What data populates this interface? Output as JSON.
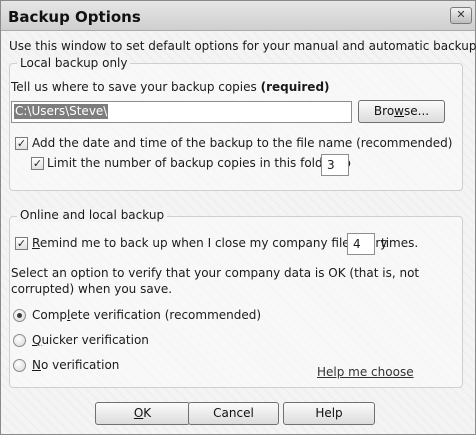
{
  "window": {
    "title": "Backup Options",
    "close_glyph": "✕",
    "intro_text": "Use this window to set default options for your manual and automatic backups."
  },
  "local_backup": {
    "group_title": "Local backup only",
    "location_prompt": "Tell us where to save your backup copies ",
    "location_required": "(required)",
    "location_value": "C:\\Users\\Steve\\",
    "browse_label_pre": "Bro",
    "browse_label_mnemonic": "w",
    "browse_label_post": "se...",
    "add_datetime_checked": true,
    "add_datetime_label": "Add the date and time of the backup to the file name (recommended)",
    "limit_copies_checked": true,
    "limit_copies_label": "Limit the number of backup copies in this folder to",
    "limit_copies_value": "3"
  },
  "online_local_backup": {
    "group_title": "Online and local backup",
    "remind_checked": true,
    "remind_mnemonic": "R",
    "remind_label_rest": "emind me to back up when I close my company file every",
    "remind_value": "4",
    "remind_suffix": "times.",
    "verify_prompt_line1": "Select an option to verify that your company data is OK (that is, not",
    "verify_prompt_line2": "corrupted) when you save.",
    "verification_options": [
      {
        "pre": "Comp",
        "mnemonic": "l",
        "post": "ete verification (recommended)",
        "selected": true
      },
      {
        "pre": "",
        "mnemonic": "Q",
        "post": "uicker verification",
        "selected": false
      },
      {
        "pre": "",
        "mnemonic": "N",
        "post": "o verification",
        "selected": false
      }
    ],
    "help_link": "Help me choose"
  },
  "buttons": {
    "ok_mnemonic": "O",
    "ok_rest": "K",
    "cancel": "Cancel",
    "help": "Help"
  },
  "colors": {
    "selection_bg": "#7d7d7d",
    "window_bg": "#f4f4f4"
  },
  "icons": {
    "close": "close-icon",
    "checkmark": "checkmark-icon",
    "radio_dot": "radio-selected-icon"
  }
}
